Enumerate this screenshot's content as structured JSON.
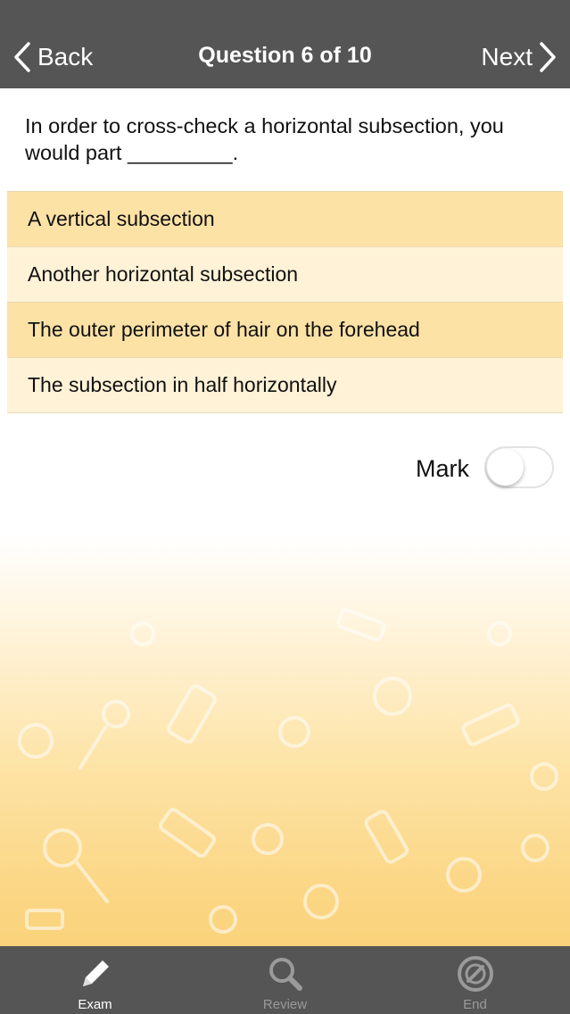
{
  "navbar": {
    "back_label": "Back",
    "title": "Question 6 of 10",
    "next_label": "Next"
  },
  "question": {
    "text": "In order to cross-check a horizontal subsection, you would part _________."
  },
  "answers": [
    {
      "label": "A vertical subsection",
      "shade": "dark"
    },
    {
      "label": "Another horizontal subsection",
      "shade": "light"
    },
    {
      "label": "The outer perimeter of hair on the forehead",
      "shade": "dark"
    },
    {
      "label": "The subsection in half horizontally",
      "shade": "light"
    }
  ],
  "mark": {
    "label": "Mark",
    "on": false
  },
  "tabbar": {
    "tabs": [
      {
        "label": "Exam",
        "icon": "pencil-icon",
        "active": true
      },
      {
        "label": "Review",
        "icon": "magnifier-icon",
        "active": false
      },
      {
        "label": "End",
        "icon": "end-icon",
        "active": false
      }
    ]
  },
  "colors": {
    "navbar_bg": "#555556",
    "answer_dark": "#fde2a6",
    "answer_light": "#fff2d7",
    "tab_active": "#ffffff",
    "tab_inactive": "#9a9a9a"
  }
}
